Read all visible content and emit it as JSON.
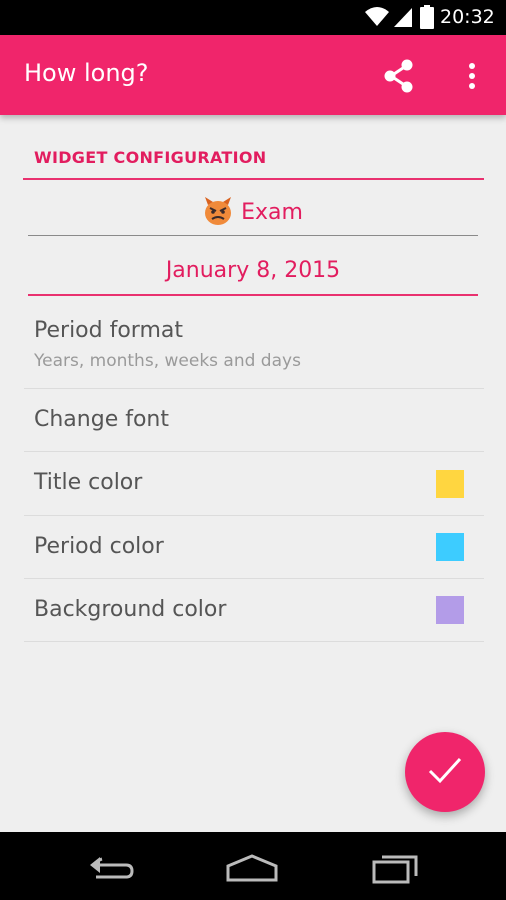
{
  "status_bar": {
    "time": "20:32",
    "icons": [
      "wifi-icon",
      "signal-icon",
      "battery-icon"
    ]
  },
  "app_bar": {
    "title": "How long?",
    "share_icon": "share-icon",
    "overflow_icon": "overflow-menu-icon",
    "color": "#f0256b"
  },
  "config": {
    "section_header": "WIDGET CONFIGURATION",
    "event_emoji": "angry-devil-icon",
    "event_title": "Exam",
    "event_date": "January 8, 2015",
    "accent_color": "#e21d5f"
  },
  "settings": {
    "period_format": {
      "label": "Period format",
      "value": "Years, months, weeks and days"
    },
    "change_font": {
      "label": "Change font"
    },
    "title_color": {
      "label": "Title color",
      "swatch": "#ffd640"
    },
    "period_color": {
      "label": "Period color",
      "swatch": "#3dccff"
    },
    "background_color": {
      "label": "Background color",
      "swatch": "#b39ce8"
    }
  },
  "fab": {
    "icon": "check-icon"
  },
  "nav_bar": {
    "icons": [
      "back-icon",
      "home-icon",
      "recents-icon"
    ]
  }
}
